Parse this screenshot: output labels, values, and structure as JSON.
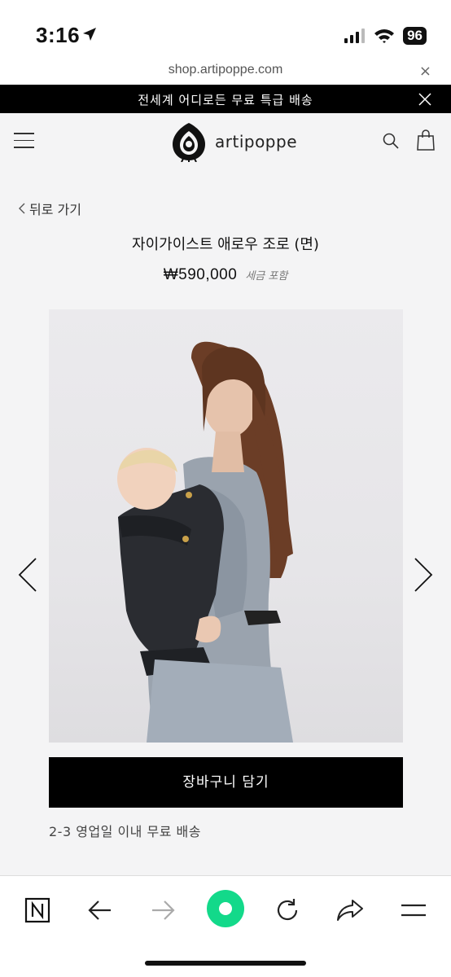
{
  "status_bar": {
    "time": "3:16",
    "battery": "96"
  },
  "browser": {
    "url": "shop.artipoppe.com",
    "close_label": "×"
  },
  "announcement": {
    "text": "전세계 어디로든 무료 특급 배송"
  },
  "header": {
    "brand": "artipoppe"
  },
  "nav": {
    "back_label": "뒤로 가기"
  },
  "product": {
    "title": "자이가이스트 애로우 조로 (면)",
    "price": "₩590,000",
    "tax_note": "세금 포함",
    "add_to_cart_label": "장바구니 담기",
    "shipping_note": "2-3 영업일 이내 무료 배송"
  },
  "toolbar": {
    "items": [
      "notion-icon",
      "back-arrow-icon",
      "forward-arrow-icon",
      "record-icon",
      "reload-icon",
      "share-icon",
      "menu-icon"
    ],
    "accent": "#13d98a"
  }
}
